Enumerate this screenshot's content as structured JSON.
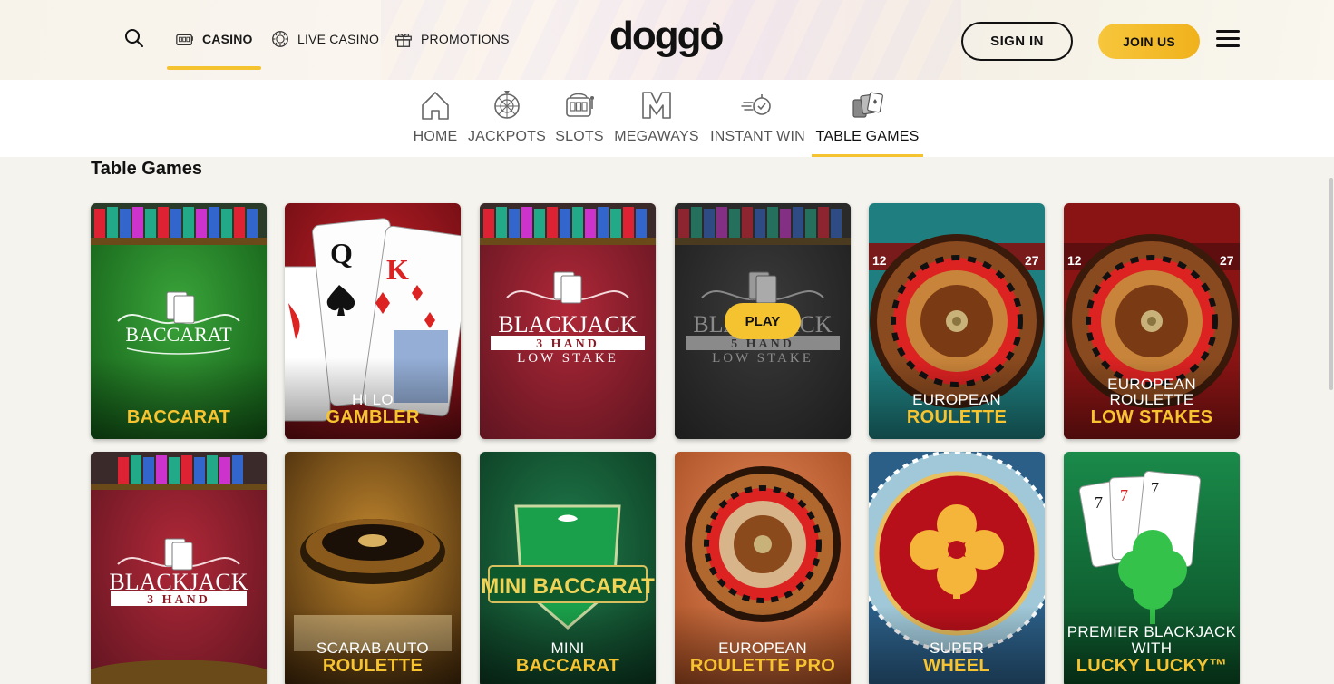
{
  "header": {
    "search_icon": "search-icon",
    "nav": [
      {
        "label": "CASINO",
        "icon": "slot-machine-icon",
        "active": true
      },
      {
        "label": "LIVE CASINO",
        "icon": "casino-chip-icon",
        "active": false
      },
      {
        "label": "PROMOTIONS",
        "icon": "gift-icon",
        "active": false
      }
    ],
    "logo_text": "doggo",
    "sign_in": "SIGN IN",
    "join_us": "JOIN US",
    "menu_icon": "hamburger-menu-icon"
  },
  "sub_nav": [
    {
      "label": "HOME",
      "icon": "home-icon",
      "active": false
    },
    {
      "label": "JACKPOTS",
      "icon": "jackpot-wheel-icon",
      "active": false
    },
    {
      "label": "SLOTS",
      "icon": "slot-machine-icon",
      "active": false
    },
    {
      "label": "MEGAWAYS",
      "icon": "megaways-m-icon",
      "active": false
    },
    {
      "label": "INSTANT WIN",
      "icon": "instant-win-icon",
      "active": false
    },
    {
      "label": "TABLE GAMES",
      "icon": "playing-cards-icon",
      "active": true
    }
  ],
  "section_title": "Table Games",
  "colors": {
    "accent_yellow": "#f5c230",
    "page_bg": "#f4f3ee",
    "text_dark": "#111111"
  },
  "games": [
    {
      "line1": "",
      "line2": "BACCARAT",
      "art_text": "BACCARAT"
    },
    {
      "line1": "HI LO",
      "line2": "GAMBLER",
      "art_text": ""
    },
    {
      "line1": "",
      "line2": "",
      "art_text": "BLACKJACK",
      "art_sub": "3 HAND",
      "art_sub2": "LOW STAKE"
    },
    {
      "line1": "",
      "line2": "",
      "art_text": "BLACKJACK",
      "art_sub": "5 HAND",
      "art_sub2": "LOW STAKE",
      "play": "PLAY"
    },
    {
      "line1": "EUROPEAN",
      "line2": "ROULETTE",
      "art_text": ""
    },
    {
      "line1": "EUROPEAN ROULETTE",
      "line2": "LOW STAKES",
      "art_text": ""
    },
    {
      "line1": "",
      "line2": "",
      "art_text": "BLACKJACK",
      "art_sub": "3 HAND"
    },
    {
      "line1": "SCARAB AUTO",
      "line2": "ROULETTE",
      "art_text": ""
    },
    {
      "line1": "MINI",
      "line2": "BACCARAT",
      "art_text": "MINI BACCARAT"
    },
    {
      "line1": "EUROPEAN",
      "line2": "ROULETTE PRO",
      "art_text": ""
    },
    {
      "line1": "SUPER",
      "line2": "WHEEL",
      "art_text": ""
    },
    {
      "line1": "PREMIER BLACKJACK",
      "line1b": "WITH",
      "line2": "LUCKY LUCKY™",
      "art_text": ""
    }
  ]
}
